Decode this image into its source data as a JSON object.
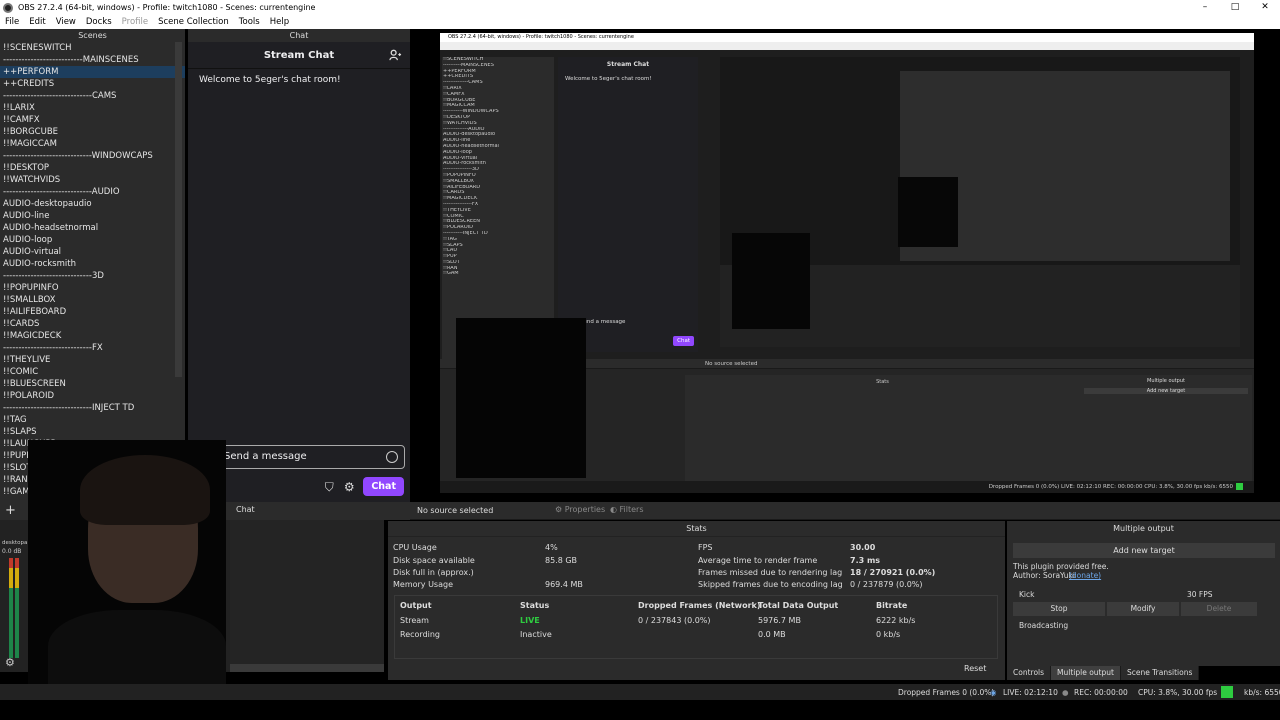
{
  "window": {
    "title": "OBS 27.2.4 (64-bit, windows) - Profile: twitch1080 - Scenes: currentengine",
    "controls": [
      "–",
      "□",
      "✕"
    ]
  },
  "menu": [
    "File",
    "Edit",
    "View",
    "Docks",
    "Profile",
    "Scene Collection",
    "Tools",
    "Help"
  ],
  "menu_disabled": [
    "Profile"
  ],
  "docks": {
    "scenes_title": "Scenes",
    "chat_title": "Chat"
  },
  "scenes": [
    "!!SCENESWITCH",
    "--------------------------MAINSCENES",
    "++PERFORM",
    "++CREDITS",
    "-----------------------------CAMS",
    "!!LARIX",
    "!!CAMFX",
    "!!BORGCUBE",
    "!!MAGICCAM",
    "-----------------------------WINDOWCAPS",
    "!!DESKTOP",
    "!!WATCHVIDS",
    "-----------------------------AUDIO",
    "AUDIO-desktopaudio",
    "AUDIO-line",
    "AUDIO-headsetnormal",
    "AUDIO-loop",
    "AUDIO-virtual",
    "AUDIO-rocksmith",
    "-----------------------------3D",
    "!!POPUPINFO",
    "!!SMALLBOX",
    "!!AILIFEBOARD",
    "!!CARDS",
    "!!MAGICDECK",
    "-----------------------------FX",
    "!!THEYLIVE",
    "!!COMIC",
    "!!BLUESCREEN",
    "!!POLAROID",
    "-----------------------------INJECT TD",
    "!!TAG",
    "!!SLAPS",
    "!!LAUNCHPR",
    "!!PUPPE",
    "!!SLOT",
    "!!RAND",
    "!!GAME"
  ],
  "selected_scene": "++PERFORM",
  "chat": {
    "header": "Stream Chat",
    "welcome": "Welcome to 5eger's chat room!",
    "input_placeholder": "Send a message",
    "chat_button": "Chat",
    "tab_label": "Chat"
  },
  "sources": {
    "add": "+"
  },
  "audio": {
    "track": "desktopa",
    "level": "0.0 dB"
  },
  "properties_bar": {
    "no_source": "No source selected",
    "properties": "Properties",
    "filters": "Filters"
  },
  "stats": {
    "title": "Stats",
    "left": [
      {
        "label": "CPU Usage",
        "value": "4%"
      },
      {
        "label": "Disk space available",
        "value": "85.8 GB"
      },
      {
        "label": "Disk full in (approx.)",
        "value": ""
      },
      {
        "label": "Memory Usage",
        "value": "969.4 MB"
      }
    ],
    "right": [
      {
        "label": "FPS",
        "value": "30.00"
      },
      {
        "label": "Average time to render frame",
        "value": "7.3 ms"
      },
      {
        "label": "Frames missed due to rendering lag",
        "value": "18 / 270921 (0.0%)"
      },
      {
        "label": "Skipped frames due to encoding lag",
        "value": "0 / 237879 (0.0%)"
      }
    ],
    "output_headers": [
      "Output",
      "Status",
      "Dropped Frames (Network)",
      "Total Data Output",
      "Bitrate"
    ],
    "outputs": [
      {
        "output": "Stream",
        "status": "LIVE",
        "dropped": "0 / 237843 (0.0%)",
        "total": "5976.7 MB",
        "bitrate": "6222 kb/s"
      },
      {
        "output": "Recording",
        "status": "Inactive",
        "dropped": "",
        "total": "0.0 MB",
        "bitrate": "0 kb/s"
      }
    ],
    "reset": "Reset"
  },
  "multiple_output": {
    "title": "Multiple output",
    "add_target": "Add new target",
    "free_text": "This plugin provided free.",
    "author_text": "Author: SoraYuki",
    "donate": "(donate)",
    "target_name": "Kick",
    "target_fps": "30 FPS",
    "stop": "Stop",
    "modify": "Modify",
    "delete": "Delete",
    "state": "Broadcasting"
  },
  "dock_tabs": [
    "Controls",
    "Multiple output",
    "Scene Transitions"
  ],
  "active_dock_tab": "Multiple output",
  "statusbar": {
    "dropped": "Dropped Frames 0 (0.0%)",
    "live": "LIVE: 02:12:10",
    "rec": "REC: 00:00:00",
    "cpu": "CPU: 3.8%, 30.00 fps",
    "kbps": "kb/s: 6550"
  },
  "nested": {
    "title": "OBS 27.2.4 (64-bit, windows) - Profile: twitch1080 - Scenes: currentengine",
    "chat_header": "Stream Chat",
    "welcome": "Welcome to 5eger's chat room!",
    "message": "Send a message",
    "chat_btn": "Chat",
    "no_source": "No source selected",
    "stats": "Stats",
    "multiple_output": "Multiple output",
    "add_target": "Add new target",
    "status": "Dropped Frames 0 (0.0%)   LIVE: 02:12:10   REC: 00:00:00   CPU: 3.8%, 30.00 fps   kb/s: 6550",
    "scene_lines": [
      "!!SCENESWITCH",
      "----------MAINSCENES",
      "++PERFORM",
      "++CREDITS",
      "--------------CAMS",
      "!!LARIX",
      "!!CAMFX",
      "!!BORGCUBE",
      "!!MAGICCAM",
      "-----------WINDOWCAPS",
      "!!DESKTOP",
      "!!WATCHVIDS",
      "--------------AUDIO",
      "AUDIO-desktopaudio",
      "AUDIO-line",
      "AUDIO-headsetnormal",
      "AUDIO-loop",
      "AUDIO-virtual",
      "AUDIO-rocksmith",
      "----------------3D",
      "!!POPUPINFO",
      "!!SMALLBOX",
      "!!AILIFEBOARD",
      "!!CARDS",
      "!!MAGICDECK",
      "----------------FX",
      "!!THEYLIVE",
      "!!COMIC",
      "!!BLUESCREEN",
      "!!POLAROID",
      "-----------INJECT TD",
      "!!TAG",
      "!!SLAPS",
      "!!LAU",
      "!!PUP",
      "!!SLOT",
      "!!RAN",
      "!!GAM"
    ]
  },
  "colors": {
    "accent_purple": "#9147ff",
    "live_green": "#2ecc40",
    "panel": "#2b2b2b",
    "selection": "#1d3e5e"
  }
}
